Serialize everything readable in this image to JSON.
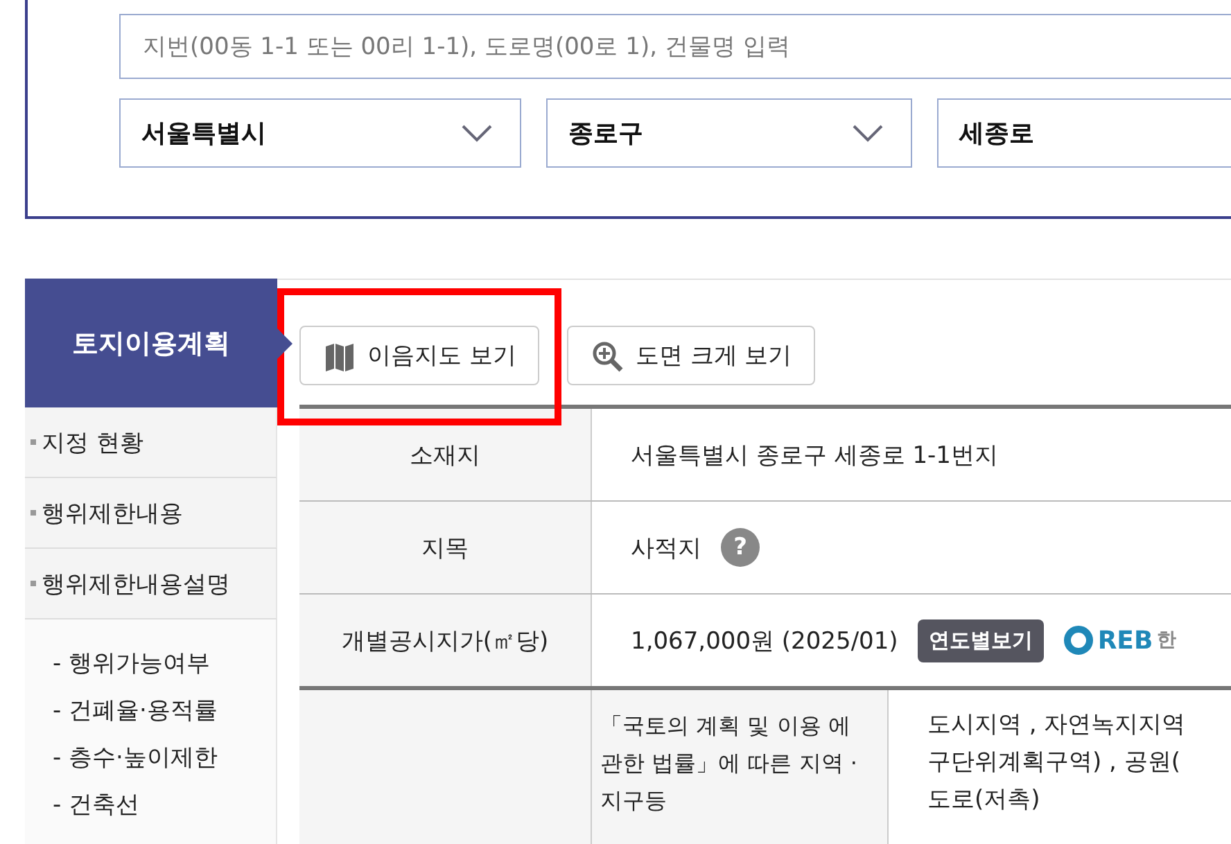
{
  "search": {
    "placeholder": "지번(00동 1-1 또는 00리 1-1), 도로명(00로 1), 건물명 입력"
  },
  "selects": [
    {
      "value": "서울특별시"
    },
    {
      "value": "종로구"
    },
    {
      "value": "세종로"
    }
  ],
  "sidebar": {
    "title": "토지이용계획",
    "items": [
      "지정 현황",
      "행위제한내용",
      "행위제한내용설명"
    ],
    "sub_items": [
      "- 행위가능여부",
      "- 건폐율·용적률",
      "- 층수·높이제한",
      "- 건축선"
    ]
  },
  "buttons": [
    {
      "label": "이음지도 보기",
      "kind": "map",
      "highlighted": true
    },
    {
      "label": "도면 크게 보기",
      "kind": "zoom",
      "highlighted": false
    }
  ],
  "info_table": {
    "rows": [
      {
        "label": "소재지",
        "value": "서울특별시 종로구 세종로 1-1번지",
        "kind": "text"
      },
      {
        "label": "지목",
        "value": "사적지",
        "kind": "help",
        "help_icon": "?"
      },
      {
        "label": "개별공시지가(㎡당)",
        "value": "1,067,000원 (2025/01)",
        "kind": "price",
        "badge": "연도별보기",
        "logo": "REB",
        "logo_text": "한"
      }
    ],
    "zone_row": {
      "sublabel": "「국토의 계획 및 이용 에 관한 법률」에 따른 지역 · 지구등",
      "value_lines": [
        "도시지역 , 자연녹지지역",
        "구단위계획구역) , 공원(",
        "도로(저촉)"
      ]
    }
  }
}
